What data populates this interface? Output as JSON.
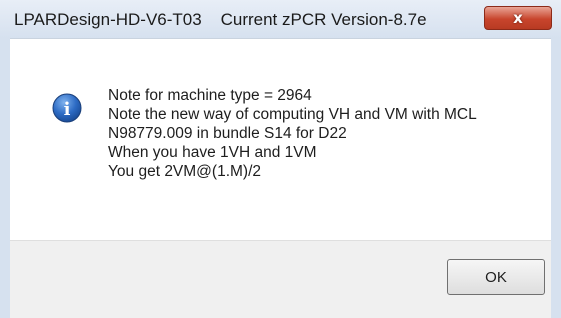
{
  "window": {
    "title": "LPARDesign-HD-V6-T03    Current zPCR Version-8.7e",
    "close_label": "x",
    "close_icon": "close-icon"
  },
  "dialog": {
    "icon": "info-icon",
    "icon_glyph": "i",
    "icon_color": "#2d6bc4",
    "messages": [
      "Note for machine type = 2964",
      "Note the new way of computing VH and VM with MCL",
      "N98779.009 in bundle S14 for D22",
      "When you have 1VH and 1VM",
      "You get 2VM@(1.M)/2"
    ]
  },
  "buttons": {
    "ok_label": "OK"
  }
}
